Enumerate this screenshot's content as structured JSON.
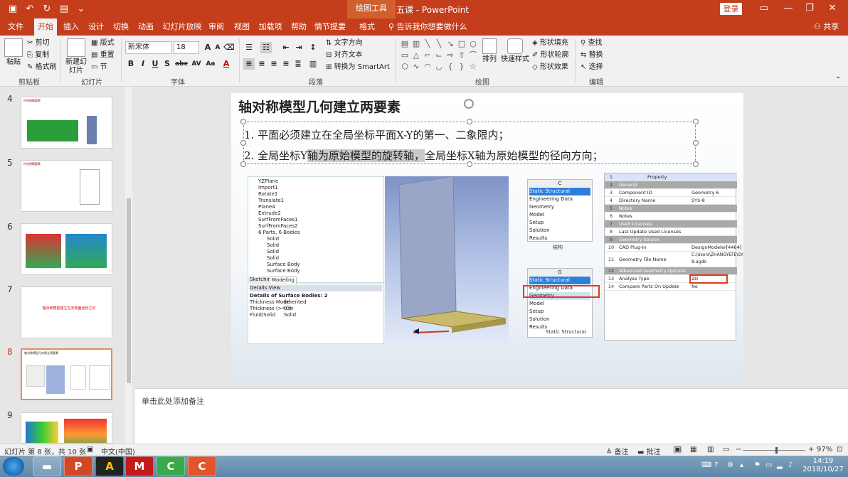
{
  "app": {
    "document_title": "第十五课 - PowerPoint",
    "context_tab": "绘图工具",
    "login": "登录"
  },
  "tabs": [
    "文件",
    "开始",
    "插入",
    "设计",
    "切换",
    "动画",
    "幻灯片放映",
    "审阅",
    "视图",
    "加载项",
    "帮助",
    "情节提要",
    "格式"
  ],
  "tell_me": "告诉我你想要做什么",
  "share": "共享",
  "ribbon": {
    "clipboard": {
      "paste": "粘贴",
      "cut": "剪切",
      "copy": "复制",
      "format_painter": "格式刷",
      "label": "剪贴板"
    },
    "slides": {
      "new_slide": "新建幻灯片",
      "layout": "版式",
      "reset": "重置",
      "section": "节",
      "label": "幻灯片"
    },
    "font": {
      "name": "新宋体",
      "size": "18",
      "label": "字体",
      "bold": "B",
      "italic": "I",
      "underline": "U",
      "shadow": "S",
      "strike": "abc",
      "spacing": "AV",
      "case": "Aa"
    },
    "paragraph": {
      "text_direction": "文字方向",
      "align_text": "对齐文本",
      "smartart": "转换为 SmartArt",
      "label": "段落"
    },
    "drawing": {
      "arrange": "排列",
      "quick_styles": "快速样式",
      "shape_fill": "形状填充",
      "shape_outline": "形状轮廓",
      "shape_effects": "形状效果",
      "label": "绘图"
    },
    "editing": {
      "find": "查找",
      "replace": "替换",
      "select": "选择",
      "label": "编辑"
    }
  },
  "thumbnails": [
    {
      "num": "4",
      "title": "符合建模要素"
    },
    {
      "num": "5",
      "title": "符合建模要素"
    },
    {
      "num": "6",
      "title": ""
    },
    {
      "num": "7",
      "title": "轴对称模型建立在无局面坐标之中"
    },
    {
      "num": "8",
      "title": "轴对称模型几何建立两要素"
    },
    {
      "num": "9",
      "title": ""
    }
  ],
  "slide": {
    "title": "轴对称模型几何建立两要素",
    "line1": "1.   平面必须建立在全局坐标平面X-Y的第一、二象限内；",
    "line2_a": "2.   全局坐标Y",
    "line2_hl": "轴为原始模型的旋转轴，",
    "line2_b": "全局坐标X轴为原始模型的径向方向；"
  },
  "tree": {
    "items": [
      "YZPlane",
      "Import1",
      "Rotate1",
      "Translate1",
      "Plane4",
      "Extrude2",
      "SurfFromFaces1",
      "SurfFromFaces2",
      "6 Parts, 6 Bodies",
      "Solid",
      "Solid",
      "Solid",
      "Solid",
      "Surface Body",
      "Surface Body"
    ],
    "tabs": [
      "Sketching",
      "Modeling"
    ],
    "details_title": "Details View",
    "details_header": "Details of Surface Bodies: 2",
    "details_rows": [
      [
        "Thickness Mode",
        "Inherited"
      ],
      [
        "Thickness (>=0)",
        "0 m"
      ],
      [
        "Fluid/Solid",
        "Solid"
      ]
    ]
  },
  "workbench": {
    "system1": {
      "letter": "C",
      "rows": [
        "Static Structural",
        "Engineering Data",
        "Geometry",
        "Model",
        "Setup",
        "Solution",
        "Results"
      ],
      "caption": "结构"
    },
    "system2": {
      "letter": "G",
      "rows": [
        "Static Structural",
        "Engineering Data",
        "Geometry",
        "Model",
        "Setup",
        "Solution",
        "Results"
      ],
      "caption": "Static Structural"
    }
  },
  "properties": {
    "header": "Property",
    "rows": [
      [
        "1",
        "Property",
        "",
        "head"
      ],
      [
        "2",
        "General",
        "",
        "sec"
      ],
      [
        "3",
        "Component ID",
        "Geometry 6",
        ""
      ],
      [
        "4",
        "Directory Name",
        "SYS-8",
        ""
      ],
      [
        "5",
        "Notes",
        "",
        "sec"
      ],
      [
        "6",
        "Notes",
        "",
        ""
      ],
      [
        "7",
        "Used Licenses",
        "",
        "sec"
      ],
      [
        "8",
        "Last Update Used Licenses",
        "",
        ""
      ],
      [
        "9",
        "Geometry Source",
        "",
        "sec"
      ],
      [
        "10",
        "CAD Plug-In",
        "DesignModeler[4464]",
        ""
      ],
      [
        "11",
        "Geometry File Name",
        "C:\\Users\\ZHANGYEFE\\SYS-8.agdb",
        "tall"
      ],
      [
        "12",
        "Advanced Geometry Options",
        "",
        "sec"
      ],
      [
        "13",
        "Analyse Type",
        "2D",
        ""
      ],
      [
        "14",
        "Compare Parts On Update",
        "No",
        ""
      ]
    ]
  },
  "notes_placeholder": "单击此处添加备注",
  "status": {
    "slide_info": "幻灯片 第 8 张，共 10 张",
    "language": "中文(中国)",
    "notes": "备注",
    "comments": "批注",
    "zoom": "97%"
  },
  "taskbar": {
    "time": "14:19",
    "date": "2018/10/27",
    "apps": [
      "P",
      "A",
      "M",
      "C",
      "C"
    ]
  }
}
